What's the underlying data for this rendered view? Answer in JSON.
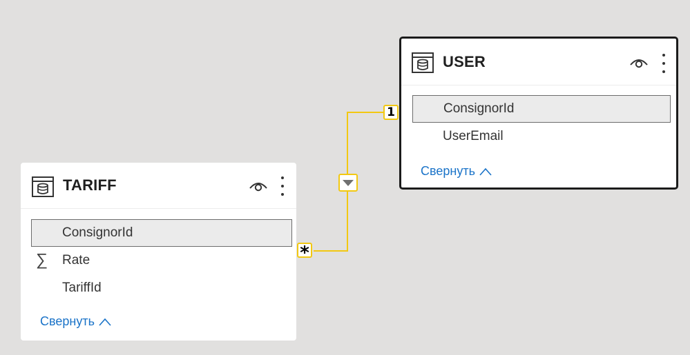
{
  "relationship": {
    "one_side_label": "1",
    "many_side_label": "*",
    "line_color": "#f2c811",
    "direction_icon": "triangle-down-icon"
  },
  "tables": {
    "tariff": {
      "title": "TARIFF",
      "icon": "table-icon",
      "fields": [
        {
          "name": "ConsignorId",
          "selected": true,
          "icon": ""
        },
        {
          "name": "Rate",
          "selected": false,
          "icon": "sigma-icon"
        },
        {
          "name": "TariffId",
          "selected": false,
          "icon": ""
        }
      ],
      "collapse_label": "Свернуть"
    },
    "user": {
      "title": "USER",
      "icon": "table-icon",
      "fields": [
        {
          "name": "ConsignorId",
          "selected": true,
          "icon": ""
        },
        {
          "name": "UserEmail",
          "selected": false,
          "icon": ""
        }
      ],
      "collapse_label": "Свернуть"
    }
  },
  "colors": {
    "canvas": "#e1e0df",
    "link": "#1a73c8",
    "selected_border": "#1b1b1b"
  }
}
